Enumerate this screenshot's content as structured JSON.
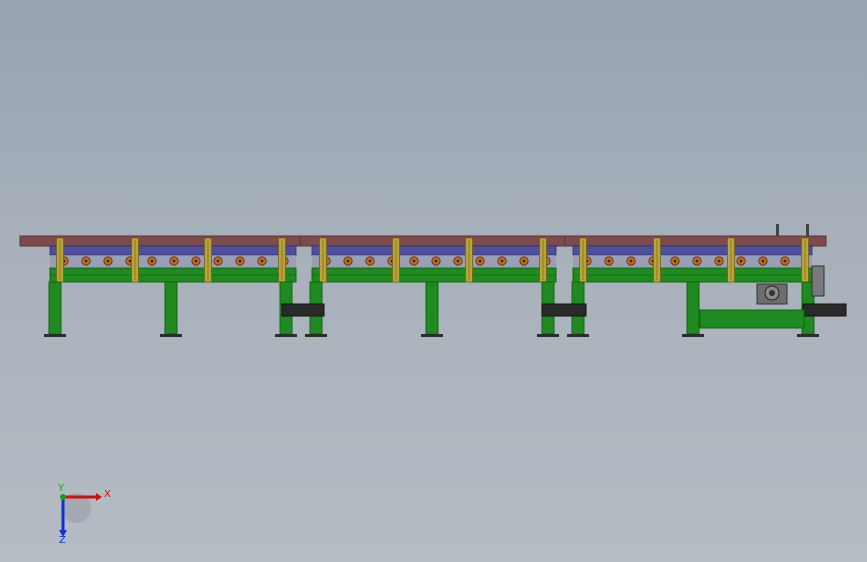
{
  "viewport": {
    "background_top": "#97a3b1",
    "background_bottom": "#b5bcc4"
  },
  "model": {
    "description_colors": {
      "deck": "#7d4a4e",
      "deck_edge": "#5a3438",
      "roller_band": "#4e4f9c",
      "sprocket": "#c06a1c",
      "post": "#b9a43a",
      "frame": "#1f8a1f",
      "frame_dark": "#116611",
      "clamp": "#2a2a2a",
      "motor": "#6d6d6d"
    },
    "sections": 3,
    "posts_per_section": [
      4,
      4,
      4
    ]
  },
  "triad": {
    "x_label": "X",
    "y_label": "Y",
    "z_label": "Z",
    "x_color": "#d01010",
    "y_color": "#10a010",
    "z_color": "#1030d0"
  }
}
